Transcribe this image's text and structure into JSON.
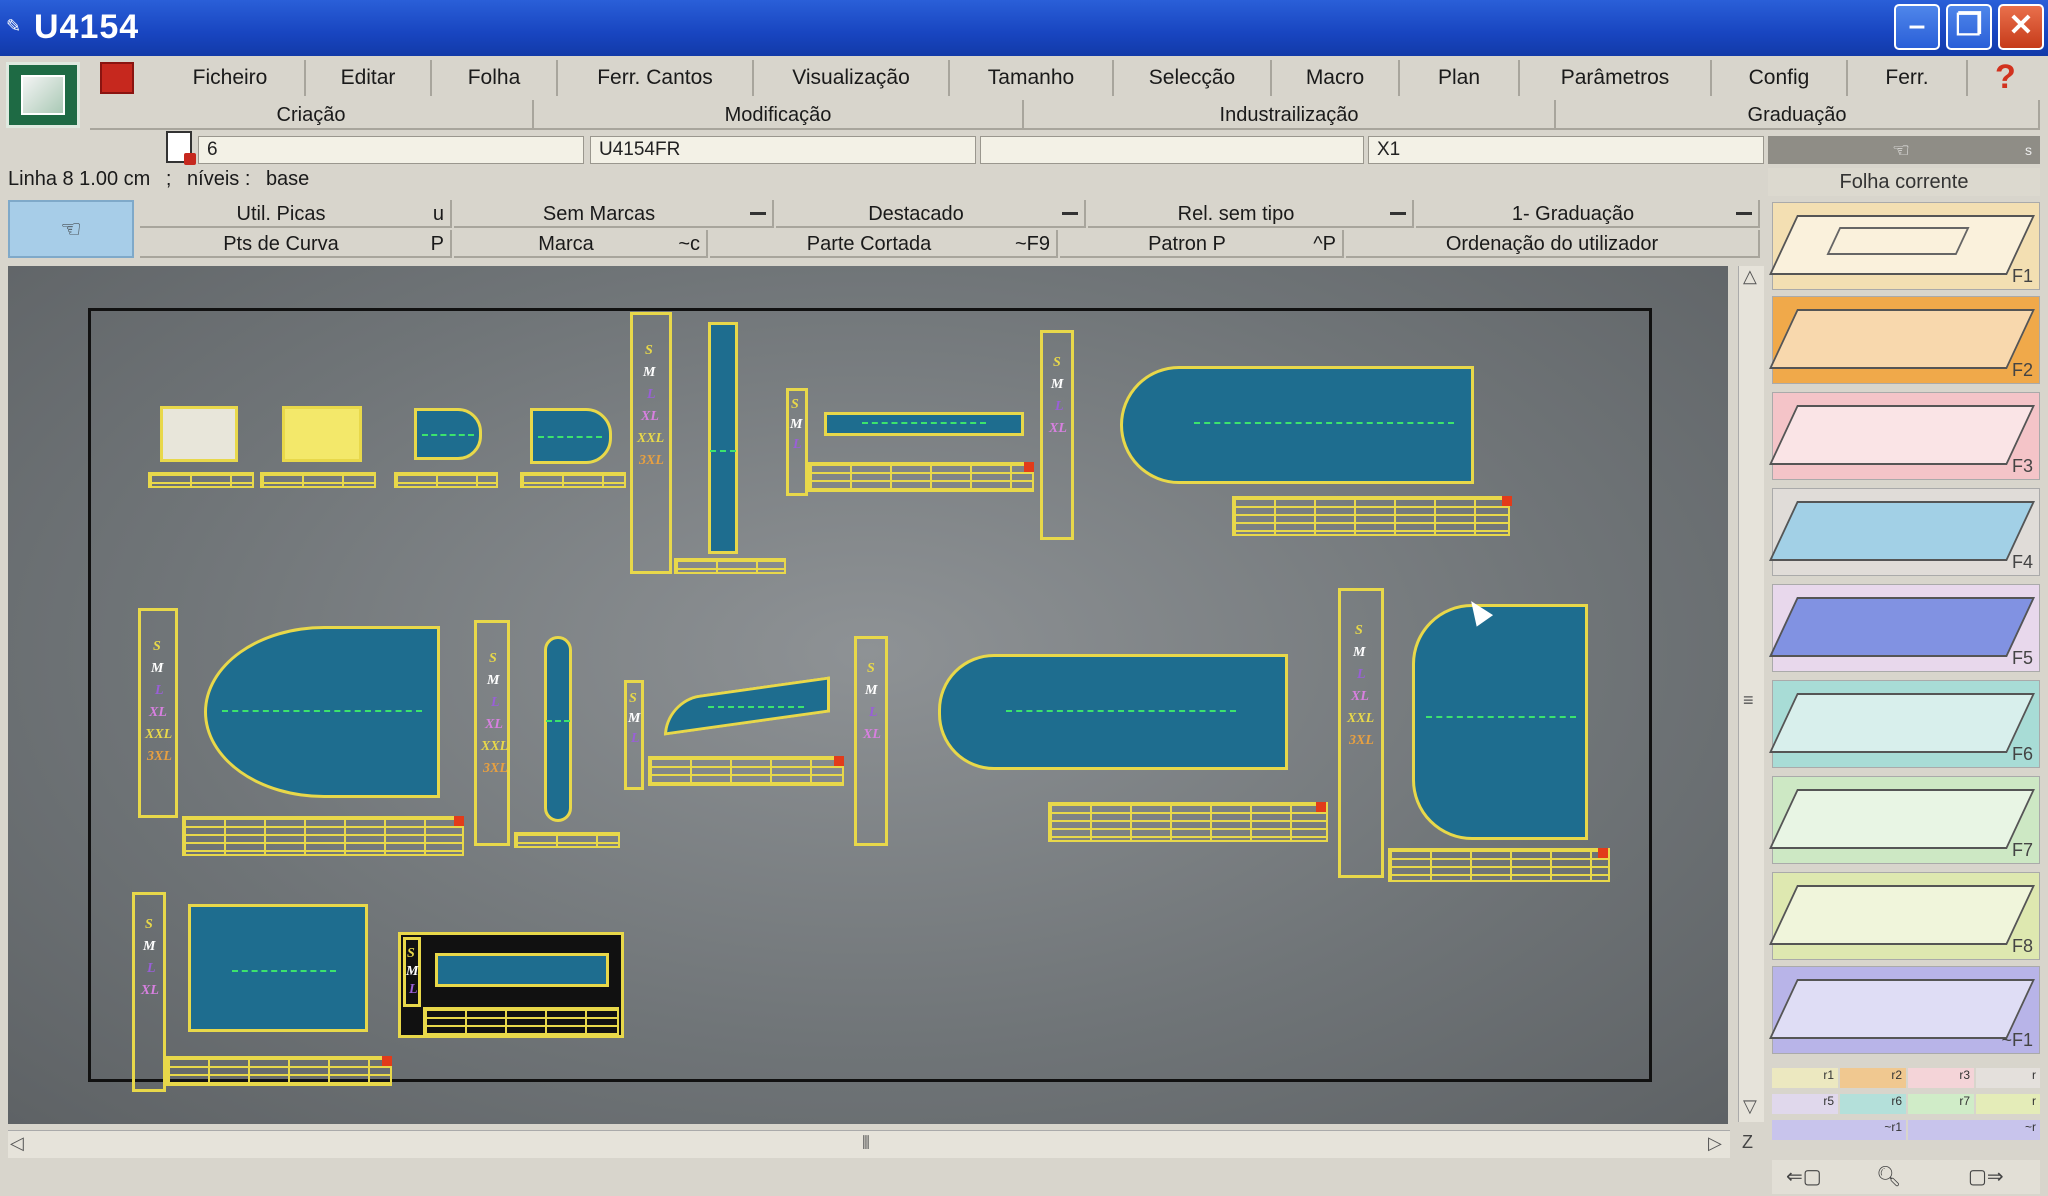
{
  "window": {
    "title": "U4154",
    "minimize": "–",
    "maximize": "❐",
    "close": "✕"
  },
  "menu": {
    "items": [
      "Ficheiro",
      "Editar",
      "Folha",
      "Ferr. Cantos",
      "Visualização",
      "Tamanho",
      "Selecção",
      "Macro",
      "Plan",
      "Parâmetros",
      "Config",
      "Ferr."
    ],
    "help": "?"
  },
  "modes": [
    "Criação",
    "Modificação",
    "Industrailização",
    "Graduação"
  ],
  "fields": {
    "f1": "6",
    "f2": "U4154FR",
    "f3": "",
    "f4": "X1"
  },
  "status": {
    "line": "Linha 8 1.00 cm",
    "sep": ";",
    "levels_label": "níveis :",
    "levels_value": "base"
  },
  "options": {
    "row1": [
      {
        "label": "Util. Picas",
        "key": "u"
      },
      {
        "label": "Sem Marcas",
        "dropdown": true
      },
      {
        "label": "Destacado",
        "dropdown": true
      },
      {
        "label": "Rel. sem tipo",
        "dropdown": true
      },
      {
        "label": "1- Graduação",
        "dropdown": true
      }
    ],
    "row2": [
      {
        "label": "Pts de Curva",
        "key": "P"
      },
      {
        "label": "Marca",
        "key": "~c"
      },
      {
        "label": "Parte Cortada",
        "key": "~F9"
      },
      {
        "label": "Patron P",
        "key": "^P"
      },
      {
        "label": "Ordenação do utilizador"
      }
    ]
  },
  "sizes": {
    "six": [
      "S",
      "M",
      "L",
      "XL",
      "XXL",
      "3XL"
    ],
    "four": [
      "S",
      "M",
      "L",
      "XL"
    ],
    "three": [
      "S",
      "M",
      "L"
    ]
  },
  "colors": {
    "piece_outline": "#e8d84a",
    "piece_fill": "#1e6d8f",
    "grain_line": "#3ce36d",
    "size_s": "#e8d84a",
    "size_m": "#ffffff",
    "size_l": "#9a5fd8",
    "size_xl": "#d880e0",
    "size_xxl": "#e8d84a",
    "size_3xl": "#e8a040"
  },
  "right_panel": {
    "title": "Folha corrente",
    "s_label": "s",
    "fkeys": [
      "F1",
      "F2",
      "F3",
      "F4",
      "F5",
      "F6",
      "F7",
      "F8",
      "~F1"
    ],
    "mini_rows": [
      [
        "r1",
        "r2",
        "r3",
        "r"
      ],
      [
        "r5",
        "r6",
        "r7",
        "r"
      ],
      [
        "~r1",
        "~r"
      ]
    ]
  },
  "scroll": {
    "z_label": "Z"
  }
}
